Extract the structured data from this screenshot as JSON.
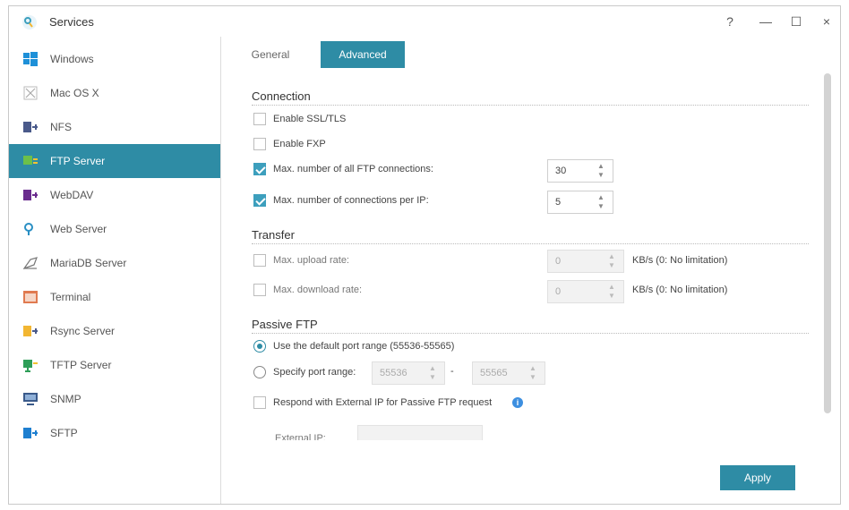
{
  "window": {
    "title": "Services",
    "help": "?",
    "minimize": "—",
    "maximize": "☐",
    "close": "×"
  },
  "sidebar": {
    "items": [
      {
        "label": "Windows",
        "icon": "windows-icon"
      },
      {
        "label": "Mac OS X",
        "icon": "macos-icon"
      },
      {
        "label": "NFS",
        "icon": "nfs-icon"
      },
      {
        "label": "FTP Server",
        "icon": "ftp-server-icon",
        "active": true
      },
      {
        "label": "WebDAV",
        "icon": "webdav-icon"
      },
      {
        "label": "Web Server",
        "icon": "web-server-icon"
      },
      {
        "label": "MariaDB Server",
        "icon": "mariadb-icon"
      },
      {
        "label": "Terminal",
        "icon": "terminal-icon"
      },
      {
        "label": "Rsync Server",
        "icon": "rsync-icon"
      },
      {
        "label": "TFTP Server",
        "icon": "tftp-icon"
      },
      {
        "label": "SNMP",
        "icon": "snmp-icon"
      },
      {
        "label": "SFTP",
        "icon": "sftp-icon"
      }
    ]
  },
  "tabs": {
    "general": "General",
    "advanced": "Advanced"
  },
  "connection": {
    "heading": "Connection",
    "ssl_label": "Enable SSL/TLS",
    "fxp_label": "Enable FXP",
    "max_all_label": "Max. number of all FTP connections:",
    "max_all_value": "30",
    "max_ip_label": "Max. number of connections per IP:",
    "max_ip_value": "5"
  },
  "transfer": {
    "heading": "Transfer",
    "upload_label": "Max. upload rate:",
    "upload_value": "0",
    "upload_unit": "KB/s (0: No limitation)",
    "download_label": "Max. download rate:",
    "download_value": "0",
    "download_unit": "KB/s (0: No limitation)"
  },
  "passive": {
    "heading": "Passive FTP",
    "default_range_label": "Use the default port range (55536-55565)",
    "specify_label": "Specify port range:",
    "port_from": "55536",
    "port_separator": "-",
    "port_to": "55565",
    "external_ip_label": "Respond with External IP for Passive FTP request",
    "info": "i",
    "external_ip_field_label": "External IP:"
  },
  "footer": {
    "apply": "Apply"
  },
  "colors": {
    "accent": "#2e8ca5",
    "checkbox": "#3d9fbd",
    "info": "#3d8fe0"
  }
}
